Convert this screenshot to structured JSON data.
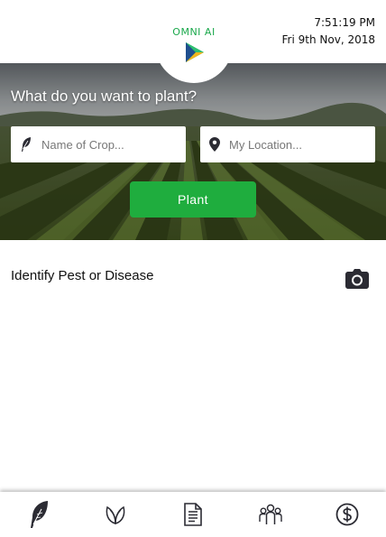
{
  "app": {
    "logo_text": "OMNI AI"
  },
  "header": {
    "time": "7:51:19 PM",
    "date": "Fri 9th Nov, 2018"
  },
  "hero": {
    "question": "What do you want to plant?",
    "crop_placeholder": "Name of Crop...",
    "crop_value": "",
    "location_placeholder": "My Location...",
    "location_value": "",
    "plant_label": "Plant"
  },
  "identify": {
    "label": "Identify Pest or Disease",
    "icon": "camera-icon"
  },
  "bottom_nav": {
    "items": [
      {
        "icon": "feather-icon",
        "active": true
      },
      {
        "icon": "leaf-icon",
        "active": false
      },
      {
        "icon": "document-icon",
        "active": false
      },
      {
        "icon": "people-icon",
        "active": false
      },
      {
        "icon": "dollar-icon",
        "active": false
      }
    ]
  },
  "colors": {
    "accent": "#1fad3e",
    "logo_green": "#1aa84b",
    "nav_icon": "#2b2b33"
  }
}
